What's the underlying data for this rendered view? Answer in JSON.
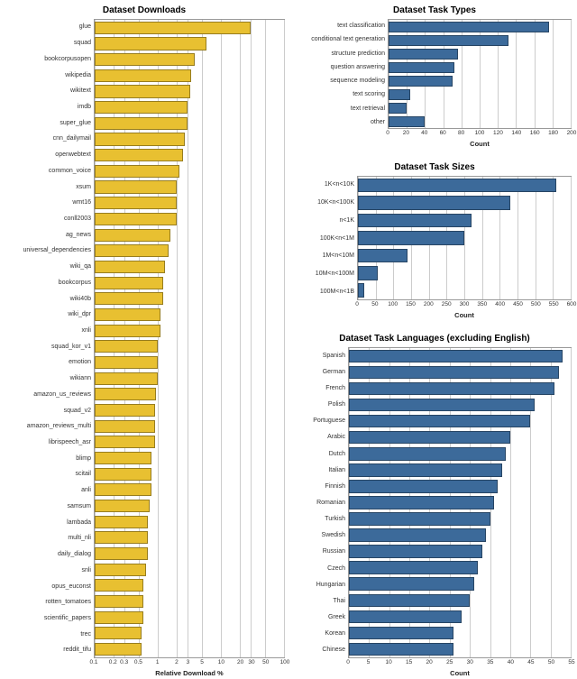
{
  "colors": {
    "yellow": "#e8c031",
    "blue": "#3c6a9a"
  },
  "chart_data": [
    {
      "id": "downloads",
      "type": "bar",
      "orientation": "horizontal",
      "title": "Dataset Downloads",
      "xlabel": "Relative Download %",
      "xscale": "log",
      "xlim": [
        0.1,
        100
      ],
      "xticks": [
        0.1,
        0.2,
        0.3,
        0.5,
        1,
        2,
        3,
        5,
        10,
        20,
        30,
        50,
        100
      ],
      "color_ref": "yellow",
      "categories": [
        "glue",
        "squad",
        "bookcorpusopen",
        "wikipedia",
        "wikitext",
        "imdb",
        "super_glue",
        "cnn_dailymail",
        "openwebtext",
        "common_voice",
        "xsum",
        "wmt16",
        "conll2003",
        "ag_news",
        "universal_dependencies",
        "wiki_qa",
        "bookcorpus",
        "wiki40b",
        "wiki_dpr",
        "xnli",
        "squad_kor_v1",
        "emotion",
        "wikiann",
        "amazon_us_reviews",
        "squad_v2",
        "amazon_reviews_multi",
        "librispeech_asr",
        "blimp",
        "scitail",
        "anli",
        "samsum",
        "lambada",
        "multi_nli",
        "daily_dialog",
        "snli",
        "opus_euconst",
        "rotten_tomatoes",
        "scientific_papers",
        "trec",
        "reddit_tifu"
      ],
      "values": [
        30,
        6.0,
        3.8,
        3.4,
        3.3,
        3.0,
        3.0,
        2.7,
        2.5,
        2.2,
        2.0,
        2.0,
        2.0,
        1.6,
        1.5,
        1.3,
        1.2,
        1.2,
        1.1,
        1.1,
        1.0,
        1.0,
        1.0,
        0.95,
        0.9,
        0.9,
        0.9,
        0.8,
        0.8,
        0.8,
        0.75,
        0.7,
        0.7,
        0.7,
        0.65,
        0.6,
        0.6,
        0.6,
        0.55,
        0.55
      ]
    },
    {
      "id": "task_types",
      "type": "bar",
      "orientation": "horizontal",
      "title": "Dataset Task Types",
      "xlabel": "Count",
      "xscale": "linear",
      "xlim": [
        0,
        200
      ],
      "xticks": [
        0,
        20,
        40,
        60,
        80,
        100,
        120,
        140,
        160,
        180,
        200
      ],
      "color_ref": "blue",
      "categories": [
        "text classification",
        "conditional text generation",
        "structure prediction",
        "question answering",
        "sequence modeling",
        "text scoring",
        "text retrieval",
        "other"
      ],
      "values": [
        176,
        132,
        76,
        72,
        70,
        24,
        20,
        40
      ]
    },
    {
      "id": "task_sizes",
      "type": "bar",
      "orientation": "horizontal",
      "title": "Dataset Task Sizes",
      "xlabel": "Count",
      "xscale": "linear",
      "xlim": [
        0,
        600
      ],
      "xticks": [
        0,
        50,
        100,
        150,
        200,
        250,
        300,
        350,
        400,
        450,
        500,
        550,
        600
      ],
      "color_ref": "blue",
      "categories": [
        "1K<n<10K",
        "10K<n<100K",
        "n<1K",
        "100K<n<1M",
        "1M<n<10M",
        "10M<n<100M",
        "100M<n<1B"
      ],
      "values": [
        560,
        430,
        320,
        300,
        140,
        55,
        18
      ]
    },
    {
      "id": "languages",
      "type": "bar",
      "orientation": "horizontal",
      "title": "Dataset Task Languages (excluding English)",
      "xlabel": "Count",
      "xscale": "linear",
      "xlim": [
        0,
        55
      ],
      "xticks": [
        0,
        5,
        10,
        15,
        20,
        25,
        30,
        35,
        40,
        45,
        50,
        55
      ],
      "color_ref": "blue",
      "categories": [
        "Spanish",
        "German",
        "French",
        "Polish",
        "Portuguese",
        "Arabic",
        "Dutch",
        "Italian",
        "Finnish",
        "Romanian",
        "Turkish",
        "Swedish",
        "Russian",
        "Czech",
        "Hungarian",
        "Thai",
        "Greek",
        "Korean",
        "Chinese"
      ],
      "values": [
        53,
        52,
        51,
        46,
        45,
        40,
        39,
        38,
        37,
        36,
        35,
        34,
        33,
        32,
        31,
        30,
        28,
        26,
        26
      ]
    }
  ]
}
